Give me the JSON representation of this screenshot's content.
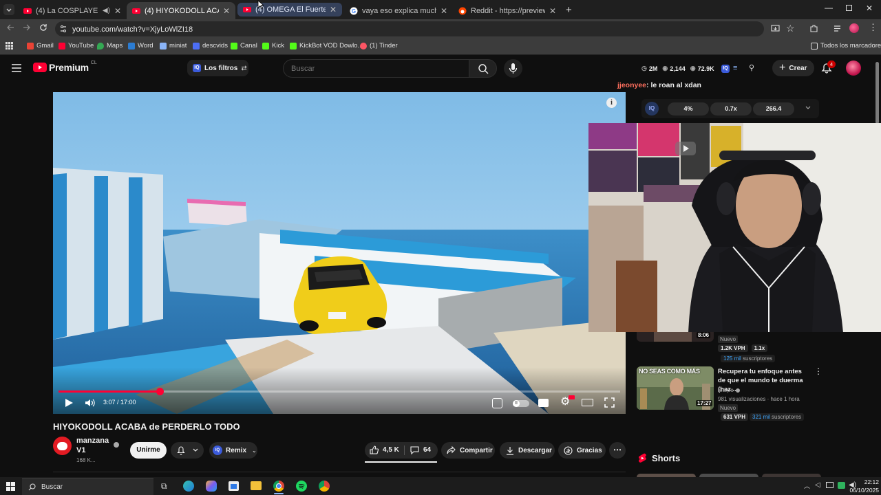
{
  "browser": {
    "tabs": [
      {
        "title": "(4) La COSPLAYER que se C",
        "active": false
      },
      {
        "title": "(4) HIYOKODOLL ACABA de PEF",
        "active": true
      },
      {
        "title": "(4) OMEGA El Fuerte - Tu Si Qu",
        "active": false
      },
      {
        "title": "vaya eso explica muchas cosas",
        "active": false
      },
      {
        "title": "Reddit - https://preview.redd.it",
        "active": false
      }
    ],
    "url": "youtube.com/watch?v=XjyLoWlZI18",
    "bookmarks": [
      "Gmail",
      "YouTube",
      "Maps",
      "Word",
      "miniat",
      "descvids",
      "Canal",
      "Kick",
      "KickBot VOD Dowlo...",
      "(1) Tinder"
    ],
    "all_bookmarks": "Todos los marcadores"
  },
  "youtube": {
    "logo": "Premium",
    "region": "CL",
    "filters_label": "Los filtros",
    "search_placeholder": "Buscar",
    "stats": {
      "subs": "2M",
      "views_a": "2,144",
      "views_b": "72.9K"
    },
    "create_label": "Crear",
    "notif_count": "4"
  },
  "chat": {
    "user": "jjeonyee",
    "message": ": le roan al xdan"
  },
  "overlay": {
    "pct": "4%",
    "mult": "0.7x",
    "value": "266.4"
  },
  "video": {
    "title": "HIYOKODOLL ACABA de PERDERLO TODO",
    "time": "3:07 / 17:00",
    "progress": 0.18,
    "channel_line1": "manzana",
    "channel_line2": "V1",
    "channel_subs": "168 K...",
    "join_label": "Unirme",
    "remix_label": "Remix",
    "likes": "4,5 K",
    "comments": "64",
    "share_label": "Compartir",
    "download_label": "Descargar",
    "thanks_label": "Gracias"
  },
  "sidebar": {
    "item1": {
      "duration": "8:06",
      "badge": "Nuevo",
      "vph": "1.2K VPH",
      "mult": "1.1x",
      "subs_num": "125 mil",
      "subs_word": "suscriptores"
    },
    "item2": {
      "title": "Recupera tu enfoque antes de que el mundo te duerma (haz ...",
      "channel": "Marpe",
      "meta": "981 visualizaciones · hace 1 hora",
      "badge": "Nuevo",
      "vph": "631 VPH",
      "subs_num": "321 mil",
      "subs_word": "suscriptores",
      "duration": "17:27",
      "thumb_text": "NO SEAS COMO MÁS"
    },
    "shorts_label": "Shorts"
  },
  "taskbar": {
    "search": "Buscar",
    "time": "22:12",
    "date": "06/10/2025"
  },
  "colors": {
    "accent": "#ff0033",
    "chat_user": "#ff6f5e",
    "subs_blue": "#3ea6ff"
  }
}
